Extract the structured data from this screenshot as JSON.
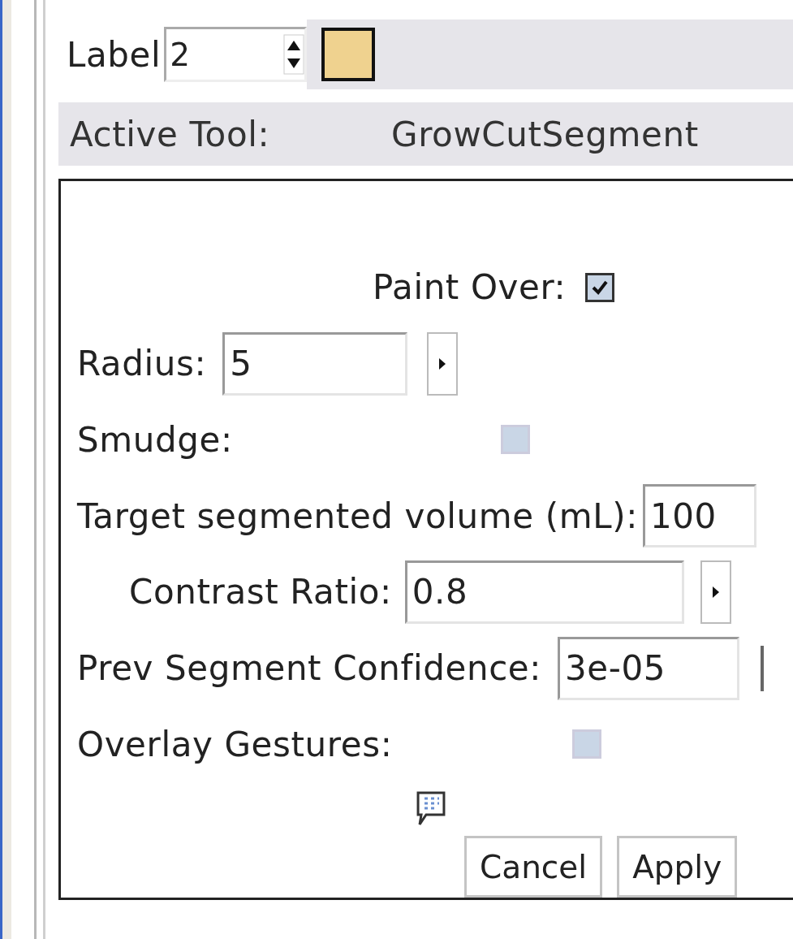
{
  "label_bar": {
    "label": "Label",
    "value": "2",
    "color": "#efd28f"
  },
  "active_tool": {
    "label": "Active Tool:",
    "value": "GrowCutSegment"
  },
  "options": [
    {
      "kind": "toggle",
      "label": "Paint Over:",
      "checked": true
    },
    {
      "kind": "spin",
      "label": "Radius:",
      "value": "5"
    },
    {
      "kind": "toggle",
      "label": "Smudge:",
      "checked": false
    },
    {
      "kind": "entry",
      "label": "Target segmented volume (mL):",
      "value": "100"
    },
    {
      "kind": "spin",
      "label": "Contrast Ratio:",
      "value": "0.8"
    },
    {
      "kind": "entry",
      "label": "Prev Segment Confidence:",
      "value": "3e-05"
    },
    {
      "kind": "toggle",
      "label": "Overlay Gestures:",
      "checked": false
    }
  ],
  "buttons": [
    "Cancel",
    "Apply"
  ]
}
